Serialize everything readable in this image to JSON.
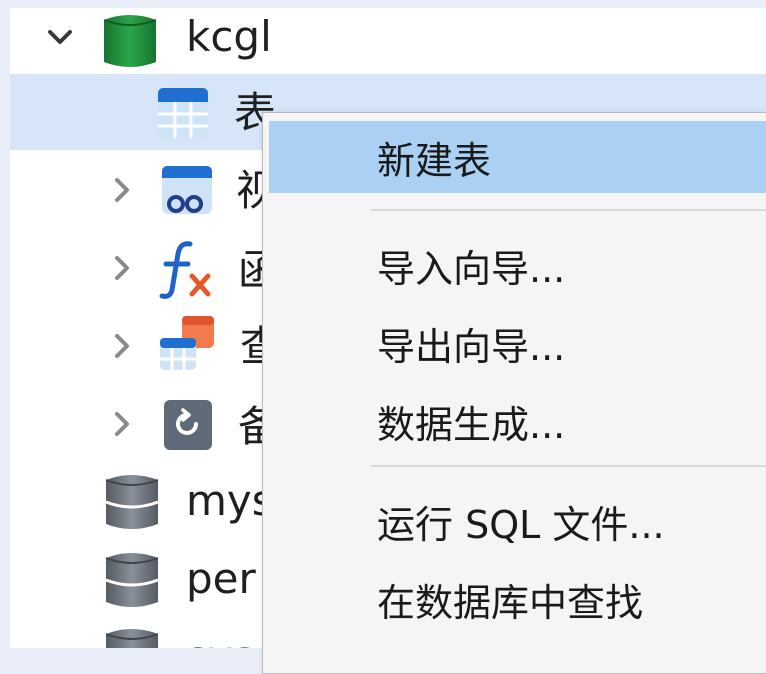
{
  "tree": {
    "database": {
      "label": "kcgl",
      "icon": "database-green-icon"
    },
    "items": [
      {
        "label": "表",
        "icon": "table-icon",
        "selected": true
      },
      {
        "label": "视",
        "icon": "view-icon"
      },
      {
        "label": "函",
        "icon": "function-icon"
      },
      {
        "label": "查",
        "icon": "query-icon"
      },
      {
        "label": "备",
        "icon": "backup-icon"
      }
    ],
    "other_databases": [
      {
        "label": "mys",
        "icon": "database-gray-icon"
      },
      {
        "label": "per",
        "icon": "database-gray-icon"
      },
      {
        "label": "sys",
        "icon": "database-gray-icon"
      }
    ]
  },
  "context_menu": {
    "items": [
      {
        "label": "新建表",
        "highlighted": true
      },
      {
        "label": "导入向导..."
      },
      {
        "label": "导出向导..."
      },
      {
        "label": "数据生成..."
      },
      {
        "label": "运行 SQL 文件..."
      },
      {
        "label": "在数据库中查找"
      }
    ]
  },
  "colors": {
    "selection": "#d6e6f8",
    "menu_highlight": "#aad1f3",
    "database_green": "#1e8b3c",
    "database_gray": "#6e6e6e"
  }
}
